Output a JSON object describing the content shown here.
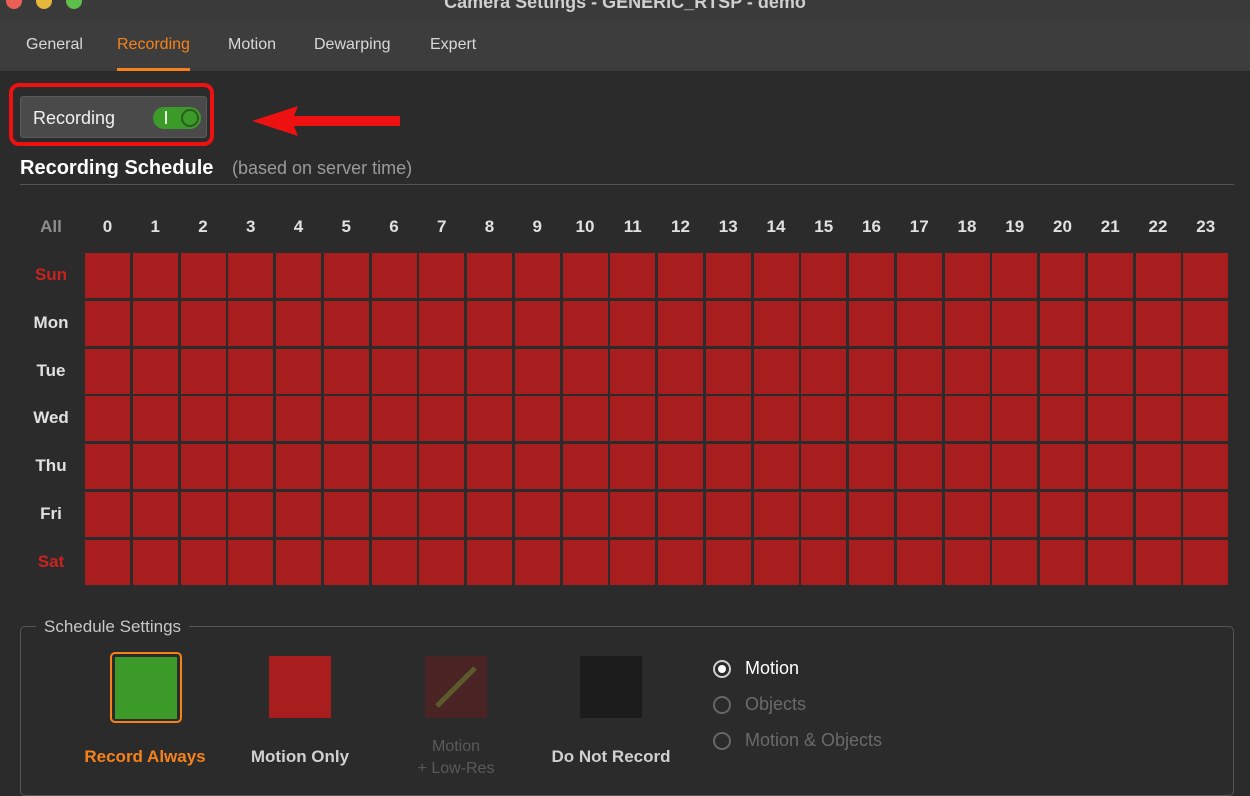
{
  "window": {
    "title": "Camera Settings - GENERIC_RTSP - demo"
  },
  "tabs": [
    {
      "label": "General",
      "active": false
    },
    {
      "label": "Recording",
      "active": true
    },
    {
      "label": "Motion",
      "active": false
    },
    {
      "label": "Dewarping",
      "active": false
    },
    {
      "label": "Expert",
      "active": false
    }
  ],
  "recording_toggle": {
    "label": "Recording",
    "on": true,
    "on_mark": "I"
  },
  "schedule": {
    "title": "Recording Schedule",
    "subtitle": "(based on server time)",
    "all_label": "All",
    "hours": [
      "0",
      "1",
      "2",
      "3",
      "4",
      "5",
      "6",
      "7",
      "8",
      "9",
      "10",
      "11",
      "12",
      "13",
      "14",
      "15",
      "16",
      "17",
      "18",
      "19",
      "20",
      "21",
      "22",
      "23"
    ],
    "days": [
      {
        "label": "Sun",
        "weekend": true
      },
      {
        "label": "Mon",
        "weekend": false
      },
      {
        "label": "Tue",
        "weekend": false
      },
      {
        "label": "Wed",
        "weekend": false
      },
      {
        "label": "Thu",
        "weekend": false
      },
      {
        "label": "Fri",
        "weekend": false
      },
      {
        "label": "Sat",
        "weekend": true
      }
    ],
    "cell_mode": "motion_only",
    "cell_color": "#a81e1e"
  },
  "schedule_settings": {
    "legend": "Schedule Settings",
    "options": [
      {
        "label": "Record Always",
        "color": "#3c9a29",
        "selected": true,
        "enabled": true
      },
      {
        "label": "Motion Only",
        "color": "#a81e1e",
        "selected": false,
        "enabled": true
      },
      {
        "label": "Motion",
        "label_line2": "+ Low-Res",
        "color": "#4a2424",
        "selected": false,
        "enabled": false
      },
      {
        "label": "Do Not Record",
        "color": "#1c1c1c",
        "selected": false,
        "enabled": true
      }
    ],
    "detection": [
      {
        "label": "Motion",
        "checked": true,
        "enabled": true
      },
      {
        "label": "Objects",
        "checked": false,
        "enabled": false
      },
      {
        "label": "Motion & Objects",
        "checked": false,
        "enabled": false
      }
    ]
  },
  "colors": {
    "accent": "#f7821b",
    "annotation": "#ee1111"
  }
}
